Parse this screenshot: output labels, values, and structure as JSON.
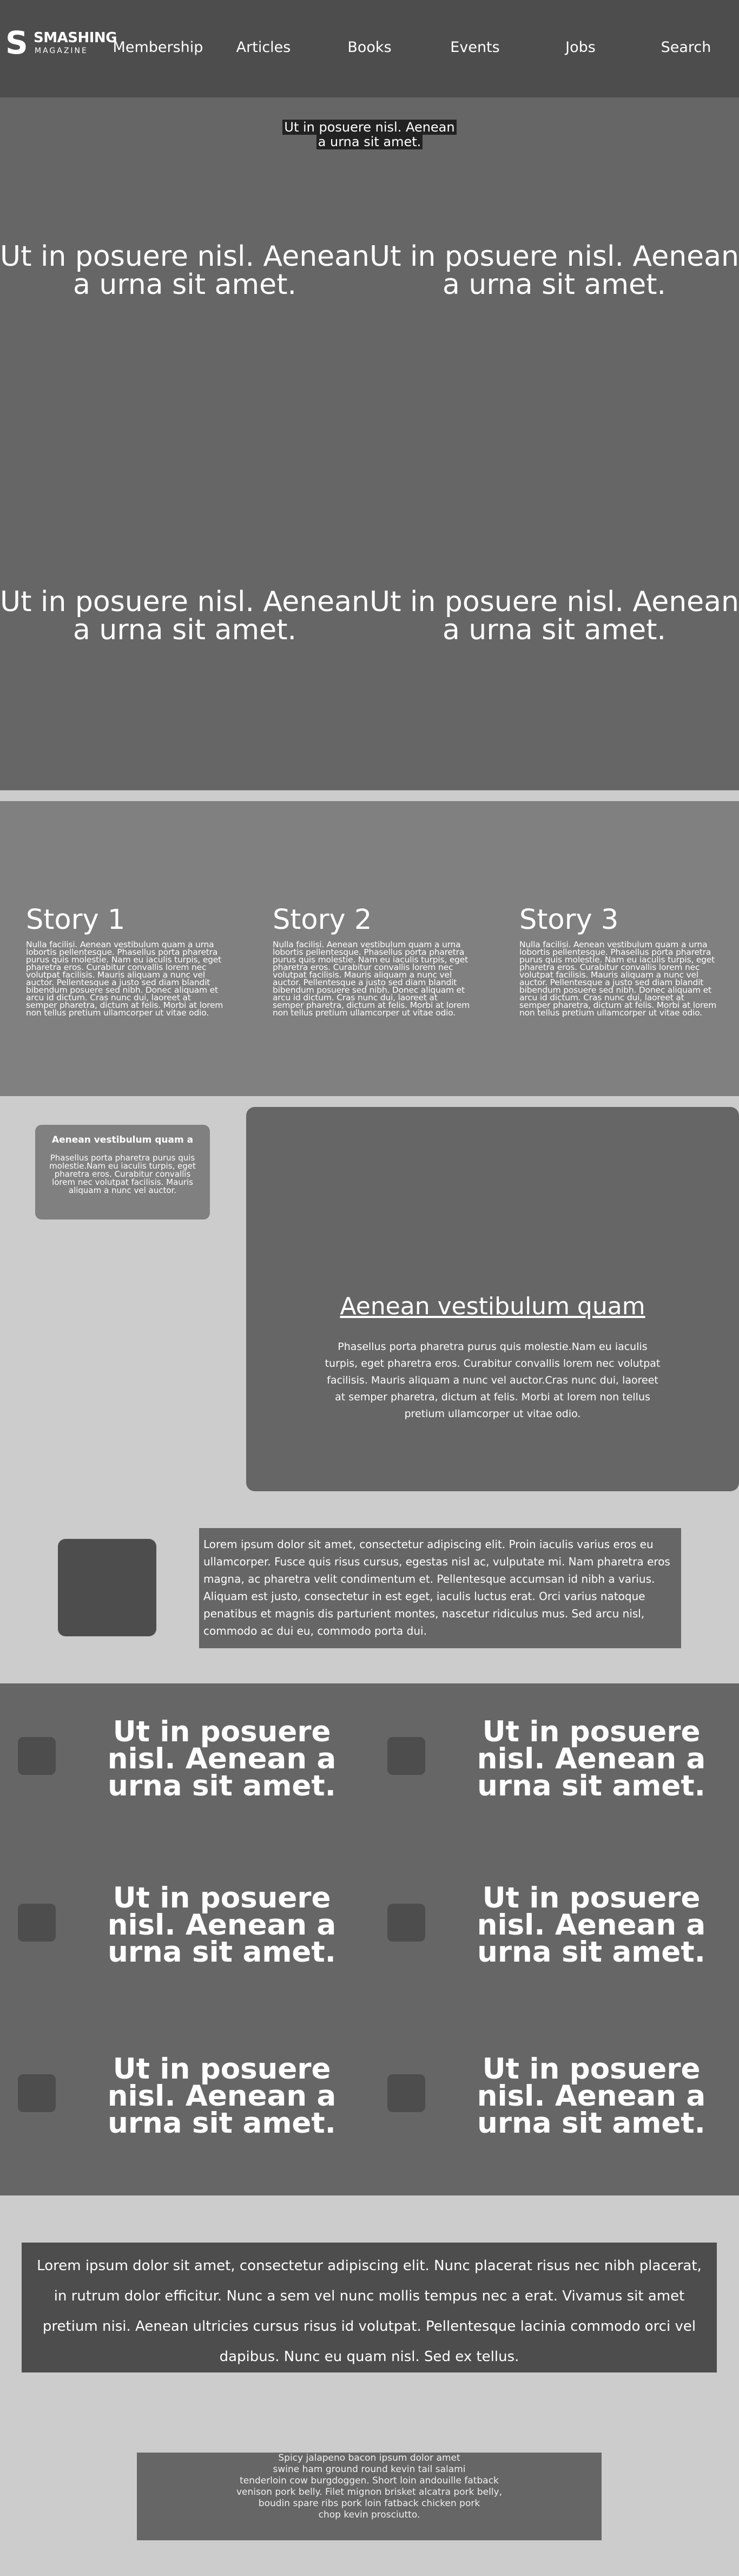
{
  "header": {
    "logo": {
      "wordmark": "SMASHING",
      "sub": "MAGAZINE",
      "mark": "S"
    },
    "nav": [
      "Membership",
      "Articles",
      "Books",
      "Events",
      "Jobs",
      "Search"
    ]
  },
  "hero": {
    "caption": "Ut in posuere nisl. Aenean a urna sit amet.",
    "tiles": [
      "Ut in posuere nisl. Aenean a urna sit amet.",
      "Ut in posuere nisl. Aenean a urna sit amet.",
      "Ut in posuere nisl. Aenean a urna sit amet.",
      "Ut in posuere nisl. Aenean a urna sit amet."
    ]
  },
  "stories": [
    {
      "title": "Story 1",
      "text": "Nulla facilisi. Aenean vestibulum quam a urna lobortis pellentesque. Phasellus porta pharetra purus quis molestie. Nam eu iaculis turpis, eget pharetra eros. Curabitur convallis lorem nec volutpat facilisis. Mauris aliquam a nunc vel auctor. Pellentesque a justo sed diam blandit bibendum posuere sed nibh. Donec aliquam et arcu id dictum. Cras nunc dui, laoreet at semper pharetra, dictum at felis. Morbi at lorem non tellus pretium ullamcorper ut vitae odio."
    },
    {
      "title": "Story 2",
      "text": "Nulla facilisi. Aenean vestibulum quam a urna lobortis pellentesque. Phasellus porta pharetra purus quis molestie. Nam eu iaculis turpis, eget pharetra eros. Curabitur convallis lorem nec volutpat facilisis. Mauris aliquam a nunc vel auctor. Pellentesque a justo sed diam blandit bibendum posuere sed nibh. Donec aliquam et arcu id dictum. Cras nunc dui, laoreet at semper pharetra, dictum at felis. Morbi at lorem non tellus pretium ullamcorper ut vitae odio."
    },
    {
      "title": "Story 3",
      "text": "Nulla facilisi. Aenean vestibulum quam a urna lobortis pellentesque. Phasellus porta pharetra purus quis molestie. Nam eu iaculis turpis, eget pharetra eros. Curabitur convallis lorem nec volutpat facilisis. Mauris aliquam a nunc vel auctor. Pellentesque a justo sed diam blandit bibendum posuere sed nibh. Donec aliquam et arcu id dictum. Cras nunc dui, laoreet at semper pharetra, dictum at felis. Morbi at lorem non tellus pretium ullamcorper ut vitae odio."
    }
  ],
  "mini_card": {
    "title": "Aenean vestibulum quam a",
    "text": "Phasellus porta pharetra purus quis molestie.Nam eu iaculis turpis, eget pharetra eros. Curabitur convallis lorem nec volutpat facilisis. Mauris aliquam a nunc vel auctor."
  },
  "big_card": {
    "title": "Aenean vestibulum quam",
    "text": "Phasellus porta pharetra purus quis molestie.Nam eu iaculis turpis, eget pharetra eros. Curabitur convallis lorem nec volutpat facilisis. Mauris aliquam a nunc vel auctor.Cras nunc dui, laoreet at semper pharetra, dictum at felis. Morbi at lorem non tellus pretium ullamcorper ut vitae odio."
  },
  "lorem_box": "Lorem ipsum dolor sit amet, consectetur adipiscing elit. Proin iaculis varius eros eu ullamcorper. Fusce quis risus cursus, egestas nisl ac, vulputate mi. Nam pharetra eros magna, ac pharetra velit condimentum et. Pellentesque accumsan id nibh a varius. Aliquam est justo, consectetur in est eget, iaculis luctus erat. Orci varius natoque penatibus et magnis dis parturient montes, nascetur ridiculus mus. Sed arcu nisl, commodo ac dui eu, commodo porta dui.",
  "grid": [
    "Ut in posuere nisl. Aenean a urna sit amet.",
    "Ut in posuere nisl. Aenean a urna sit amet.",
    "Ut in posuere nisl. Aenean a urna sit amet.",
    "Ut in posuere nisl. Aenean a urna sit amet.",
    "Ut in posuere nisl. Aenean a urna sit amet.",
    "Ut in posuere nisl. Aenean a urna sit amet."
  ],
  "quote": "Lorem ipsum dolor sit amet, consectetur adipiscing elit. Nunc placerat risus nec nibh placerat, in rutrum dolor efficitur. Nunc a sem vel nunc mollis tempus nec a erat. Vivamus sit amet pretium nisi. Aenean ultricies cursus risus id volutpat. Pellentesque lacinia commodo orci vel dapibus. Nunc eu quam nisl. Sed ex tellus.",
  "footer_lines": [
    "Spicy jalapeno bacon ipsum dolor amet",
    "swine ham ground round kevin tail salami",
    "tenderloin cow burgdoggen. Short loin andouille fatback",
    "venison pork belly. Filet mignon brisket alcatra pork belly,",
    "boudin spare ribs pork loin fatback chicken pork",
    "chop kevin prosciutto."
  ]
}
